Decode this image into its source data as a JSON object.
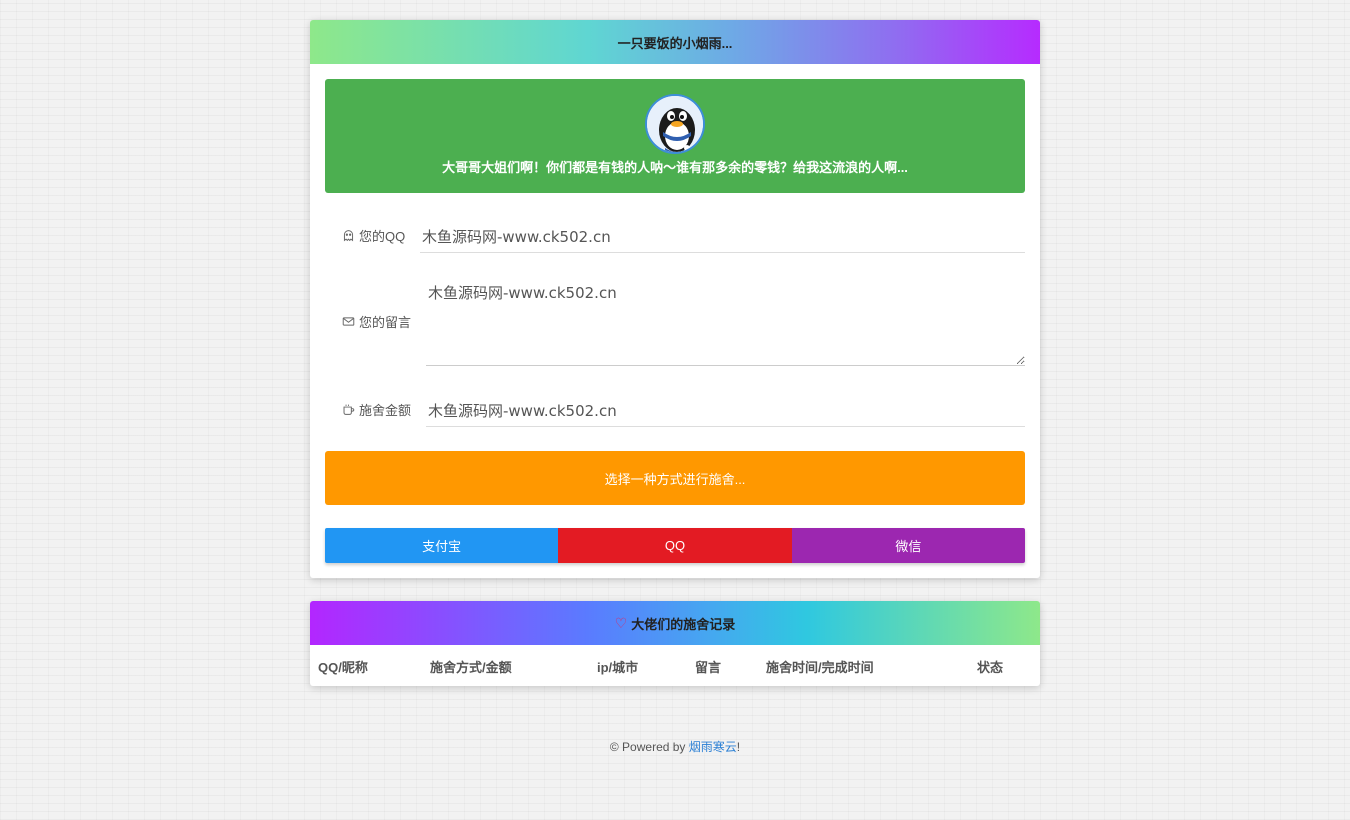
{
  "donate": {
    "title": "一只要饭的小烟雨...",
    "banner_text": "大哥哥大姐们啊！你们都是有钱的人呐～谁有那多余的零钱？给我这流浪的人啊...",
    "qq_label": "您的QQ",
    "qq_value": "木鱼源码网-www.ck502.cn",
    "message_label": "您的留言",
    "message_value": "木鱼源码网-www.ck502.cn",
    "amount_label": "施舍金额",
    "amount_value": "木鱼源码网-www.ck502.cn",
    "choose_label": "选择一种方式进行施舍...",
    "payments": [
      "支付宝",
      "QQ",
      "微信"
    ],
    "colors": {
      "banner": "#4caf50",
      "choose": "#ff9800",
      "alipay": "#2196f3",
      "qq": "#e31b23",
      "wechat": "#9c27b0"
    }
  },
  "records": {
    "title": "大佬们的施舍记录",
    "columns": [
      "QQ/昵称",
      "施舍方式/金额",
      "ip/城市",
      "留言",
      "施舍时间/完成时间",
      "状态"
    ]
  },
  "footer": {
    "prefix": "© Powered by ",
    "link": "烟雨寒云",
    "suffix": "!"
  }
}
